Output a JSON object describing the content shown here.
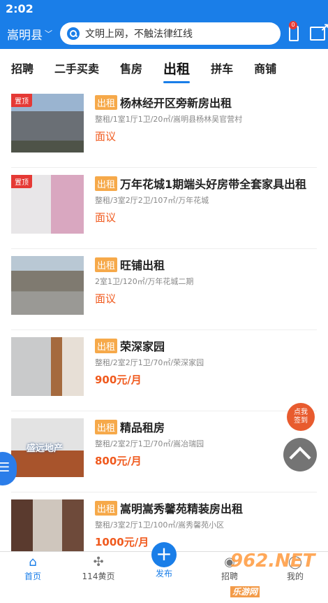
{
  "status": {
    "time": "2:02"
  },
  "header": {
    "city": "嵩明县",
    "search_placeholder": "文明上网，不触法律红线",
    "message_badge": "0"
  },
  "tabs": [
    {
      "label": "招聘"
    },
    {
      "label": "二手买卖"
    },
    {
      "label": "售房"
    },
    {
      "label": "出租",
      "active": true
    },
    {
      "label": "拼车"
    },
    {
      "label": "商铺"
    }
  ],
  "listings": [
    {
      "pinned": "置顶",
      "tag": "出租",
      "title": "杨林经开区旁新房出租",
      "meta": "整租/1室1厅1卫/20㎡/嵩明县杨林吴官营村",
      "price": "面议",
      "image": "building-photo"
    },
    {
      "pinned": "置顶",
      "tag": "出租",
      "title": "万年花城1期端头好房带全套家具出租",
      "meta": "整租/3室2厅2卫/107㎡/万年花城",
      "price": "面议",
      "image": "room-photo"
    },
    {
      "tag": "出租",
      "title": "旺铺出租",
      "meta": "2室1卫/120㎡/万年花城二期",
      "price": "面议",
      "image": "street-photo"
    },
    {
      "tag": "出租",
      "title": "荣深家园",
      "meta": "整租/2室2厅1卫/70㎡/荣深家园",
      "price": "900元/月",
      "image": "livingroom-photo"
    },
    {
      "tag": "出租",
      "title": "精品租房",
      "meta": "整租/2室2厅1卫/70㎡/嵩冶瑞园",
      "price": "800元/月",
      "image": "interior-photo",
      "logo_text": "盛远地产"
    },
    {
      "tag": "出租",
      "title": "嵩明嵩秀馨苑精装房出租",
      "meta": "整租/3室2厅1卫/100㎡/嵩秀馨苑小区",
      "price": "1000元/月",
      "image": "apartment-photo"
    }
  ],
  "floating": {
    "signin": [
      "点我",
      "签到"
    ]
  },
  "bottom_nav": [
    {
      "label": "首页",
      "icon": "home-icon",
      "active": true
    },
    {
      "label": "114黄页",
      "icon": "grid-icon"
    },
    {
      "label": "发布",
      "icon": "plus-icon"
    },
    {
      "label": "招聘",
      "icon": "briefcase-icon"
    },
    {
      "label": "我的",
      "icon": "user-icon"
    }
  ],
  "watermark": {
    "text": "962.NET",
    "sub": "乐游网"
  },
  "colors": {
    "primary": "#1a7ee8",
    "tag": "#f6a94a",
    "price": "#f05a1e",
    "pin": "#e53935"
  }
}
